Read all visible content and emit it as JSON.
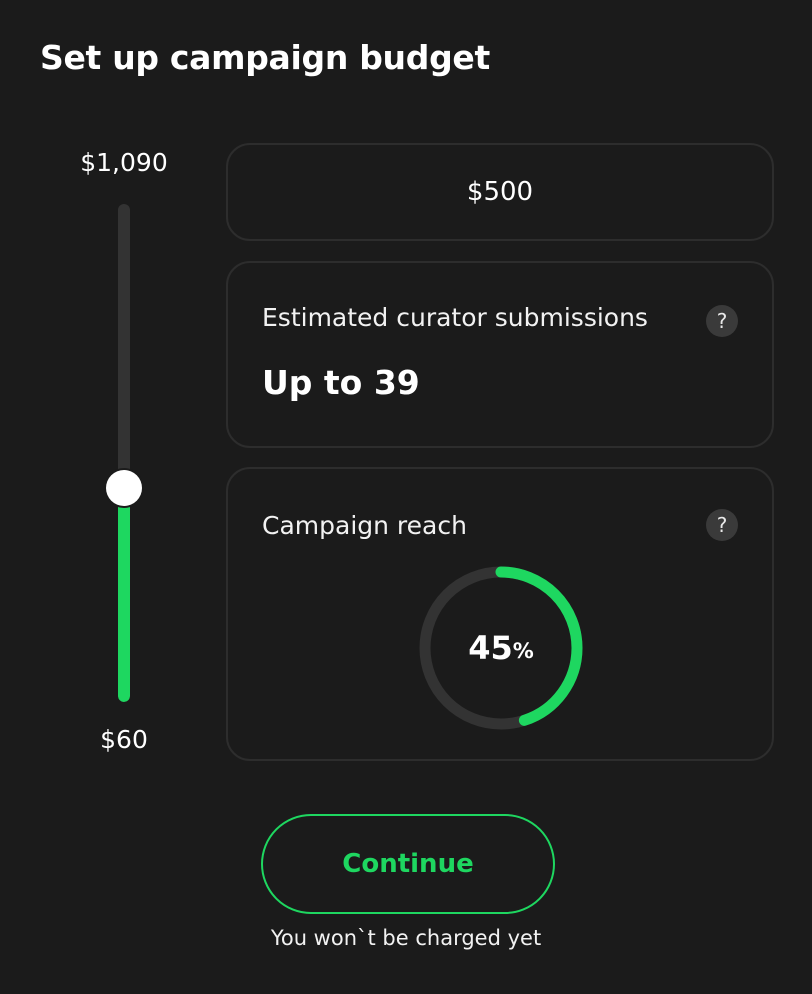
{
  "page": {
    "title": "Set up campaign budget"
  },
  "slider": {
    "max_label": "$1,090",
    "min_label": "$60",
    "level_fraction": 0.43
  },
  "budget": {
    "amount": "$500"
  },
  "submissions": {
    "label": "Estimated curator submissions",
    "value": "Up to 39",
    "help_icon": "?"
  },
  "reach": {
    "label": "Campaign reach",
    "percent_number": "45",
    "percent_unit": "%",
    "percent_value": 45,
    "help_icon": "?"
  },
  "actions": {
    "continue_label": "Continue",
    "note": "You won`t be charged yet"
  },
  "colors": {
    "background": "#1b1b1b",
    "accent": "#1ed760",
    "card_border": "#2d2d2d",
    "ring_track": "#333333"
  },
  "icons": {
    "help": "question-mark-icon",
    "slider_handle": "circle-thumb"
  }
}
